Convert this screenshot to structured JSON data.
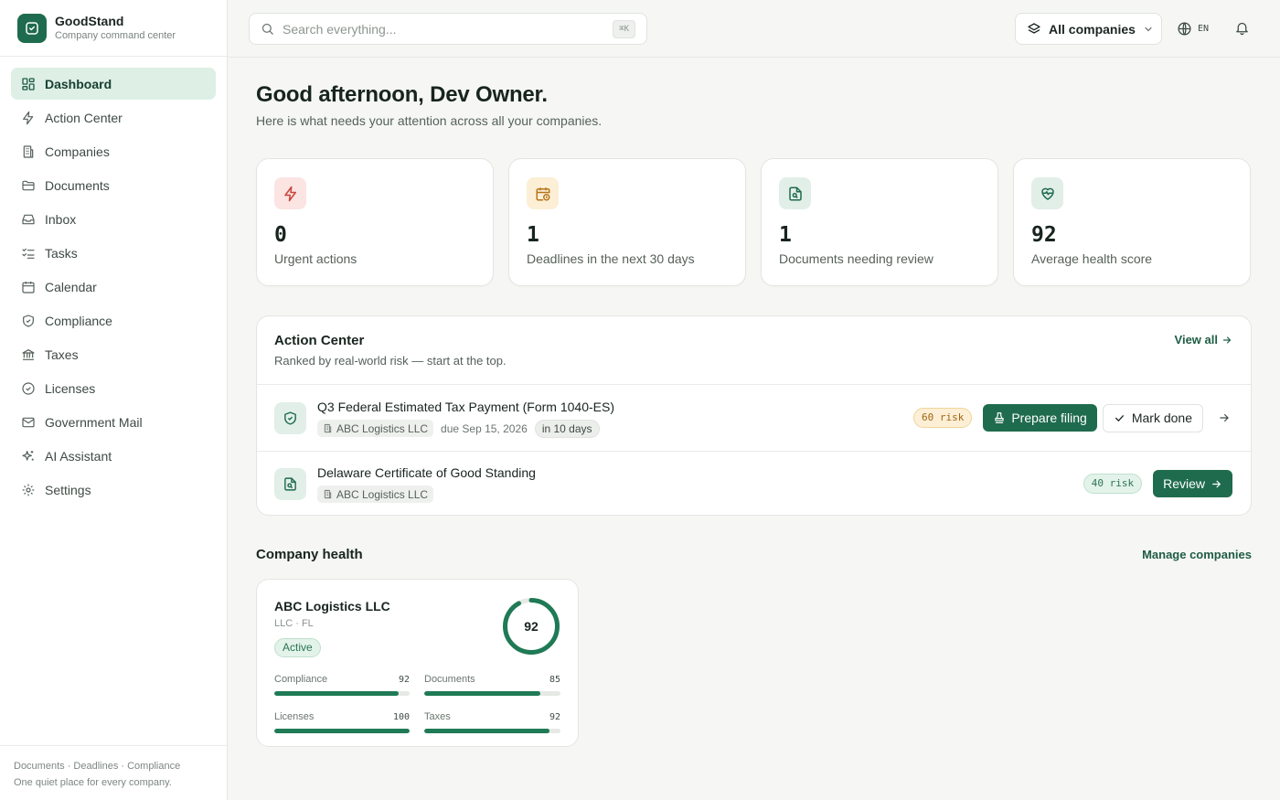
{
  "brand": {
    "name": "GoodStand",
    "tagline": "Company command center"
  },
  "nav": [
    {
      "label": "Dashboard",
      "icon": "dashboard-icon",
      "active": true
    },
    {
      "label": "Action Center",
      "icon": "bolt-icon"
    },
    {
      "label": "Companies",
      "icon": "building-icon"
    },
    {
      "label": "Documents",
      "icon": "folder-icon"
    },
    {
      "label": "Inbox",
      "icon": "inbox-icon"
    },
    {
      "label": "Tasks",
      "icon": "list-check-icon"
    },
    {
      "label": "Calendar",
      "icon": "calendar-icon"
    },
    {
      "label": "Compliance",
      "icon": "shield-check-icon"
    },
    {
      "label": "Taxes",
      "icon": "landmark-icon"
    },
    {
      "label": "Licenses",
      "icon": "badge-check-icon"
    },
    {
      "label": "Government Mail",
      "icon": "mail-icon"
    },
    {
      "label": "AI Assistant",
      "icon": "sparkles-icon"
    },
    {
      "label": "Settings",
      "icon": "gear-icon"
    }
  ],
  "sidebar_footer": {
    "line1": "Documents · Deadlines · Compliance",
    "line2": "One quiet place for every company."
  },
  "topbar": {
    "search_placeholder": "Search everything...",
    "search_shortcut": "⌘K",
    "company_switcher": "All companies",
    "language": "EN"
  },
  "greeting": {
    "title": "Good afternoon, Dev Owner.",
    "subtitle": "Here is what needs your attention across all your companies."
  },
  "stats": [
    {
      "value": "0",
      "label": "Urgent actions",
      "icon": "bolt-icon",
      "bg": "#fbe4e2",
      "fg": "#c8463c"
    },
    {
      "value": "1",
      "label": "Deadlines in the next 30 days",
      "icon": "calendar-clock-icon",
      "bg": "#fcefd6",
      "fg": "#b7741a"
    },
    {
      "value": "1",
      "label": "Documents needing review",
      "icon": "file-search-icon",
      "bg": "#e2efe8",
      "fg": "#1f6b4e"
    },
    {
      "value": "92",
      "label": "Average health score",
      "icon": "heart-pulse-icon",
      "bg": "#e2efe8",
      "fg": "#1f6b4e"
    }
  ],
  "action_center": {
    "title": "Action Center",
    "subtitle": "Ranked by real-world risk — start at the top.",
    "view_all": "View all",
    "items": [
      {
        "title": "Q3 Federal Estimated Tax Payment (Form 1040-ES)",
        "company": "ABC Logistics LLC",
        "due": "due Sep 15, 2026",
        "relative": "in 10 days",
        "risk": "60 risk",
        "primary": "Prepare filing",
        "secondary": "Mark done"
      },
      {
        "title": "Delaware Certificate of Good Standing",
        "company": "ABC Logistics LLC",
        "risk": "40 risk",
        "primary": "Review"
      }
    ]
  },
  "company_health": {
    "title": "Company health",
    "manage": "Manage companies",
    "card": {
      "name": "ABC Logistics LLC",
      "type": "LLC · FL",
      "status": "Active",
      "score": "92",
      "score_value": 92,
      "metrics": [
        {
          "label": "Compliance",
          "value": "92",
          "pct": 92
        },
        {
          "label": "Documents",
          "value": "85",
          "pct": 85
        },
        {
          "label": "Licenses",
          "value": "100",
          "pct": 100
        },
        {
          "label": "Taxes",
          "value": "92",
          "pct": 92
        }
      ]
    }
  },
  "colors": {
    "accent": "#1f6b4e",
    "accent_light": "#deefe6",
    "amber": "#a36412",
    "red": "#c8463c"
  }
}
